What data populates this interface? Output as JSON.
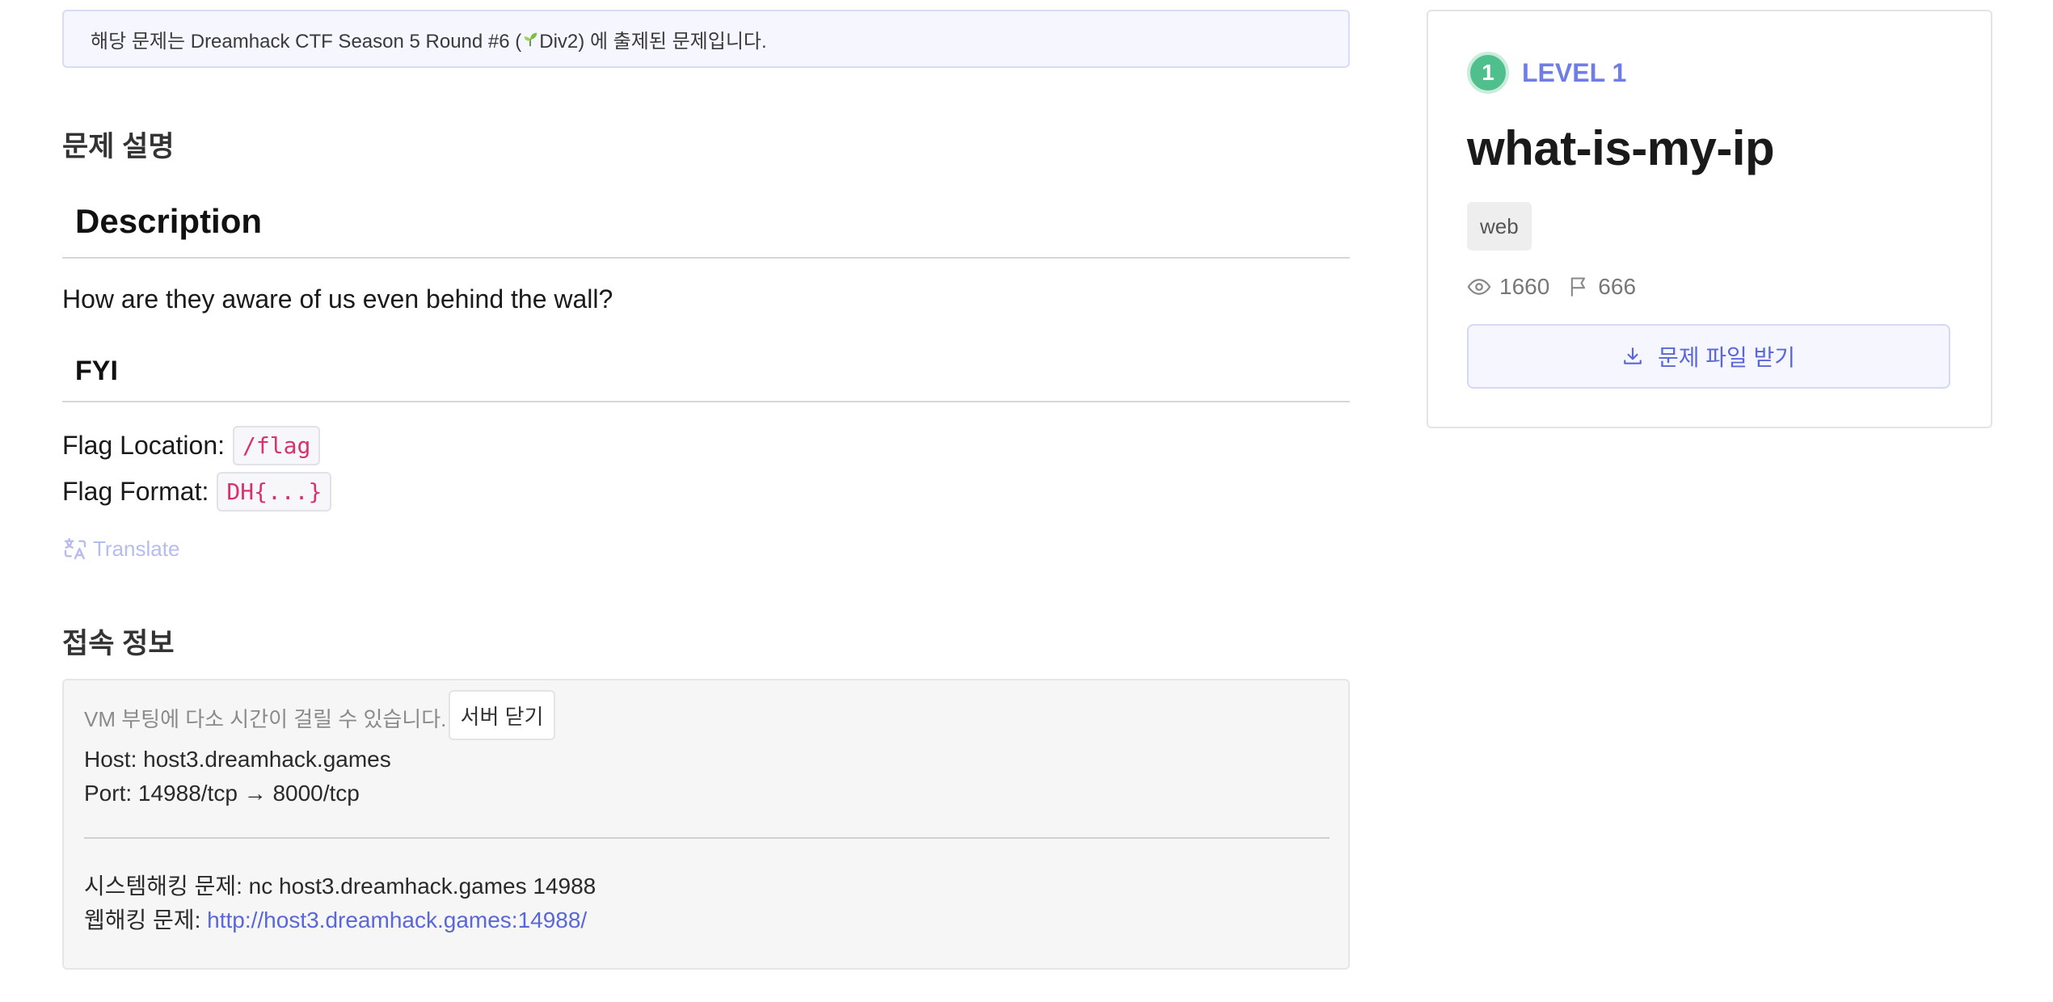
{
  "notice": {
    "prefix": "해당 문제는 Dreamhack CTF Season 5 Round #6 (",
    "suffix": "Div2) 에 출제된 문제입니다."
  },
  "sections": {
    "description_heading": "문제 설명",
    "connection_heading": "접속 정보"
  },
  "description": {
    "title": "Description",
    "body": "How are they aware of us even behind the wall?",
    "fyi_title": "FYI",
    "flag_location_label": "Flag Location:",
    "flag_location_value": "/flag",
    "flag_format_label": "Flag Format:",
    "flag_format_value": "DH{...}",
    "translate_label": "Translate"
  },
  "connection": {
    "vm_note": "VM 부팅에 다소 시간이 걸릴 수 있습니다.",
    "close_button": "서버 닫기",
    "host_line": "Host: host3.dreamhack.games",
    "port_line": "Port:  14988/tcp → 8000/tcp",
    "system_line": "시스템해킹 문제: nc host3.dreamhack.games 14988",
    "web_label": "웹해킹 문제: ",
    "web_link": "http://host3.dreamhack.games:14988/"
  },
  "card": {
    "level_number": "1",
    "level_label": "LEVEL 1",
    "title": "what-is-my-ip",
    "tag": "web",
    "views": "1660",
    "solves": "666",
    "download_label": "문제 파일 받기"
  },
  "colors": {
    "accent": "#5a67d8",
    "level_green": "#4fbf8d",
    "code_red": "#d6336c"
  }
}
